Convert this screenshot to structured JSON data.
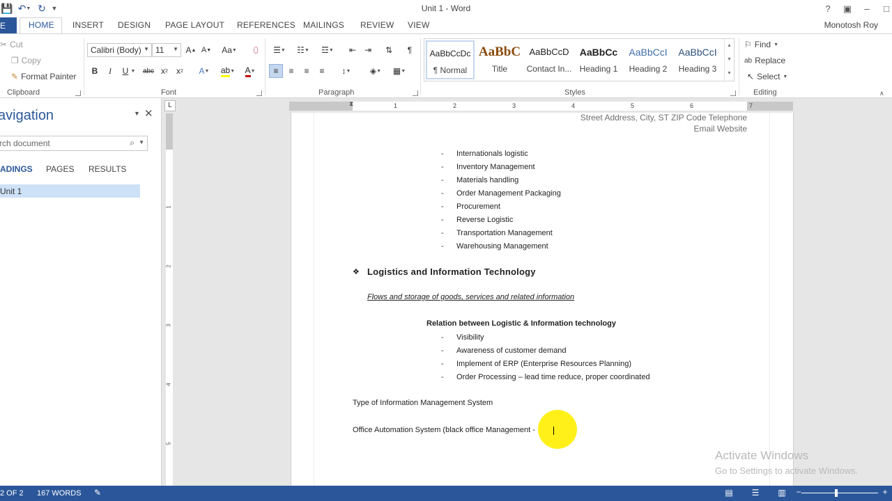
{
  "window": {
    "title": "Unit 1 - Word",
    "user": "Monotosh Roy"
  },
  "quick_access": {
    "icons": [
      "save-icon",
      "undo-icon",
      "redo-icon",
      "customize-icon"
    ]
  },
  "tabs": {
    "file": "E",
    "items": [
      "HOME",
      "INSERT",
      "DESIGN",
      "PAGE LAYOUT",
      "REFERENCES",
      "MAILINGS",
      "REVIEW",
      "VIEW"
    ]
  },
  "ribbon": {
    "clipboard": {
      "label": "Clipboard",
      "cut": "Cut",
      "copy": "Copy",
      "format_painter": "Format Painter"
    },
    "font": {
      "label": "Font",
      "name": "Calibri (Body)",
      "size": "11"
    },
    "paragraph": {
      "label": "Paragraph"
    },
    "styles": {
      "label": "Styles",
      "items": [
        {
          "preview": "AaBbCcDc",
          "name": "¶ Normal"
        },
        {
          "preview": "AaBbC",
          "name": "Title"
        },
        {
          "preview": "AaBbCcD",
          "name": "Contact In..."
        },
        {
          "preview": "AaBbCc",
          "name": "Heading 1"
        },
        {
          "preview": "AaBbCcI",
          "name": "Heading 2"
        },
        {
          "preview": "AaBbCcI",
          "name": "Heading 3"
        }
      ]
    },
    "editing": {
      "label": "Editing",
      "find": "Find",
      "replace": "Replace",
      "select": "Select"
    }
  },
  "navigation": {
    "title": "avigation",
    "search_placeholder": "rch document",
    "tabs": {
      "headings": "ADINGS",
      "pages": "PAGES",
      "results": "RESULTS"
    },
    "items": [
      "Unit 1"
    ]
  },
  "ruler": {
    "h_numbers": [
      "1",
      "2",
      "3",
      "4",
      "5",
      "6",
      "7"
    ],
    "v_numbers": [
      "1",
      "2",
      "3",
      "4",
      "5"
    ]
  },
  "document": {
    "header_line1": "Street Address, City, ST ZIP Code Telephone",
    "header_line2": "Email Website",
    "list1": [
      "Internationals logistic",
      "Inventory Management",
      "Materials handling",
      "Order Management Packaging",
      "Procurement",
      "Reverse Logistic",
      "Transportation Management",
      "Warehousing Management"
    ],
    "section_heading": "Logistics and Information Technology",
    "section_sub": "Flows and storage of goods, services and related information",
    "relation_heading": "Relation between Logistic & Information technology",
    "list2": [
      "Visibility",
      "Awareness of customer demand",
      "Implement of ERP (Enterprise Resources Planning)",
      "Order Processing – lead time reduce, proper coordinated"
    ],
    "type_line": "Type of Information Management System",
    "office_line": "Office Automation System (black office Management -"
  },
  "watermark": {
    "title": "Activate Windows",
    "subtitle": "Go to Settings to activate Windows."
  },
  "status": {
    "page": "2 OF 2",
    "words": "167 WORDS"
  }
}
